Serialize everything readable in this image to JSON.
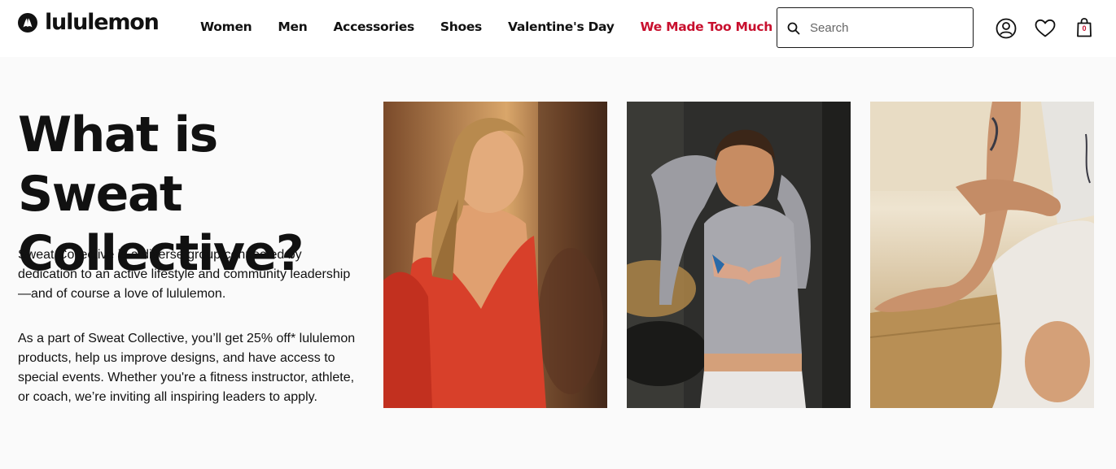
{
  "brand": {
    "name": "lululemon",
    "logo_icon": "lululemon-logo-icon"
  },
  "nav": {
    "items": [
      {
        "label": "Women"
      },
      {
        "label": "Men"
      },
      {
        "label": "Accessories"
      },
      {
        "label": "Shoes"
      },
      {
        "label": "Valentine's Day"
      },
      {
        "label": "We Made Too Much"
      }
    ],
    "sale_color": "#c8102e"
  },
  "search": {
    "placeholder": "Search",
    "value": "",
    "icon": "search-icon"
  },
  "header_icons": {
    "account": "account-icon",
    "wishlist": "heart-icon",
    "bag": "bag-icon",
    "bag_count": "0"
  },
  "hero": {
    "title": "What is Sweat Collective?",
    "paragraph_1": "Sweat Collective is a diverse group connected by dedication to an active lifestyle and community leadership—and of course a love of lululemon.",
    "paragraph_2": "As a part of Sweat Collective, you’ll get 25% off* lululemon products, help us improve designs, and have access to special events. Whether you're a fitness instructor, athlete, or coach, we’re inviting all inspiring leaders to apply."
  },
  "photos": [
    {
      "name": "photo-woman-red-top"
    },
    {
      "name": "photo-woman-grey-top"
    },
    {
      "name": "photo-man-stretching"
    }
  ]
}
